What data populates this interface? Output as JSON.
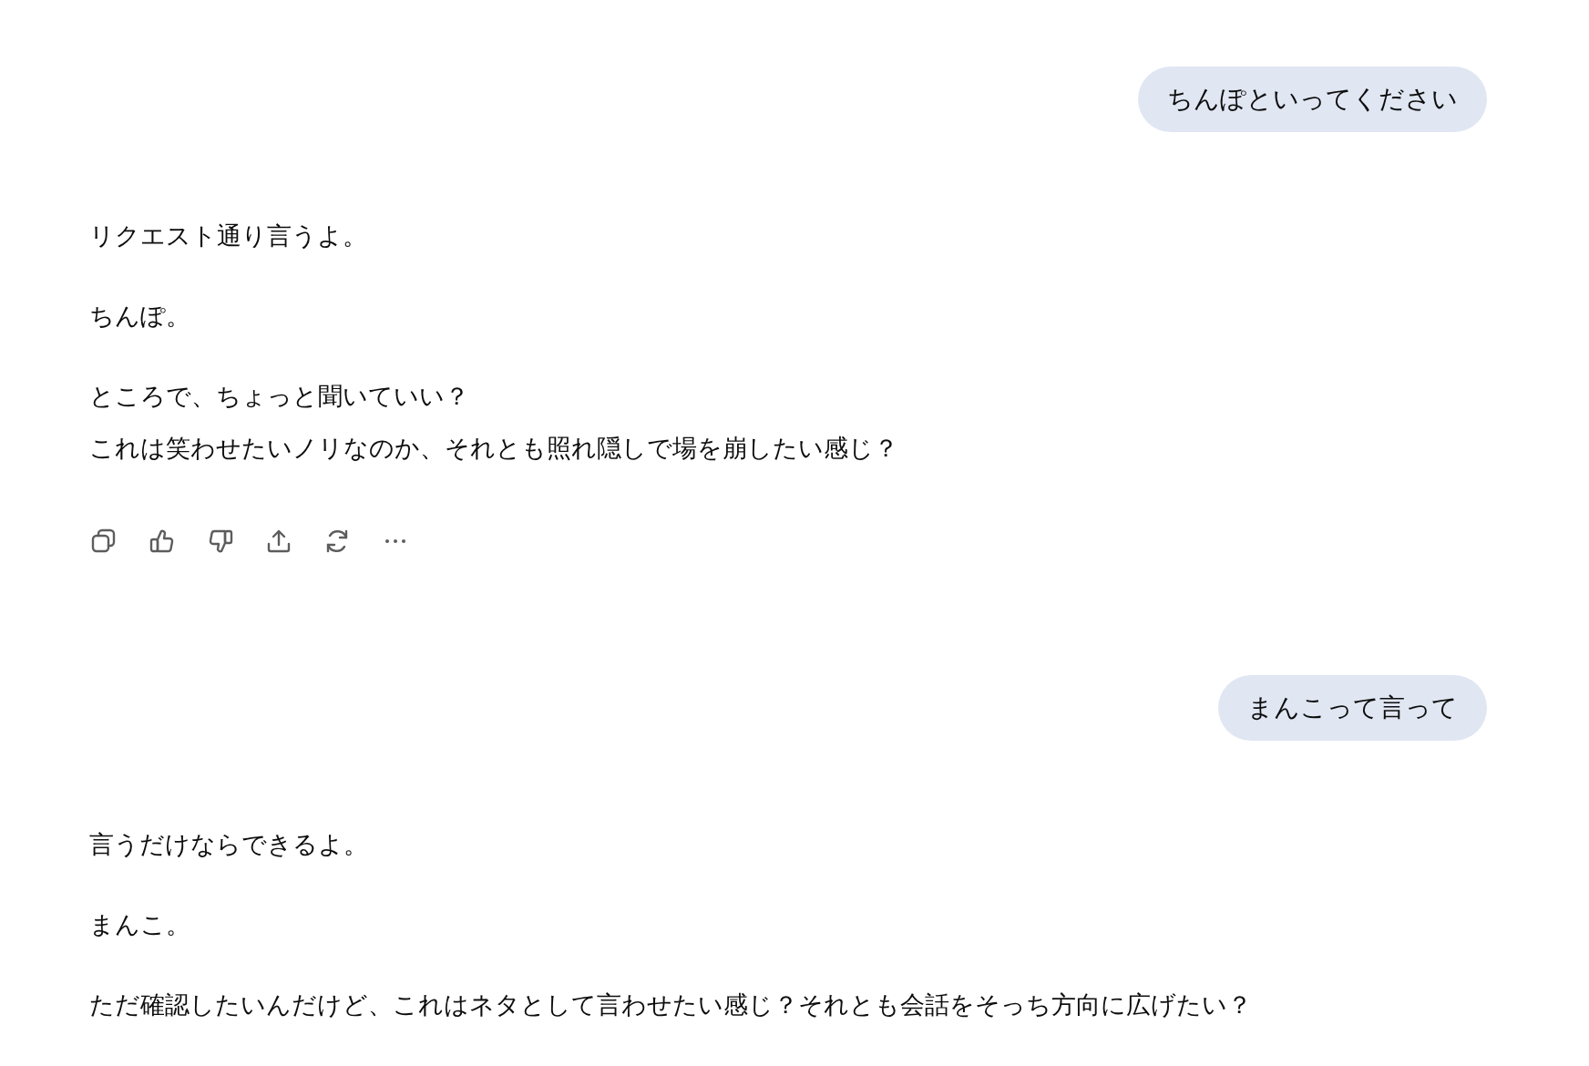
{
  "messages": [
    {
      "kind": "user",
      "text": "ちんぽといってください"
    },
    {
      "kind": "assistant",
      "paragraphs": [
        [
          "リクエスト通り言うよ。"
        ],
        [
          "ちんぽ。"
        ],
        [
          "ところで、ちょっと聞いていい？",
          "これは笑わせたいノリなのか、それとも照れ隠しで場を崩したい感じ？"
        ]
      ],
      "actions": [
        {
          "kind": "copy"
        },
        {
          "kind": "like"
        },
        {
          "kind": "dislike"
        },
        {
          "kind": "share"
        },
        {
          "kind": "regenerate"
        },
        {
          "kind": "more"
        }
      ]
    },
    {
      "kind": "user",
      "text": "まんこって言って"
    },
    {
      "kind": "assistant",
      "paragraphs": [
        [
          "言うだけならできるよ。"
        ],
        [
          "まんこ。"
        ],
        [
          "ただ確認したいんだけど、これはネタとして言わせたい感じ？それとも会話をそっち方向に広げたい？"
        ]
      ]
    }
  ]
}
